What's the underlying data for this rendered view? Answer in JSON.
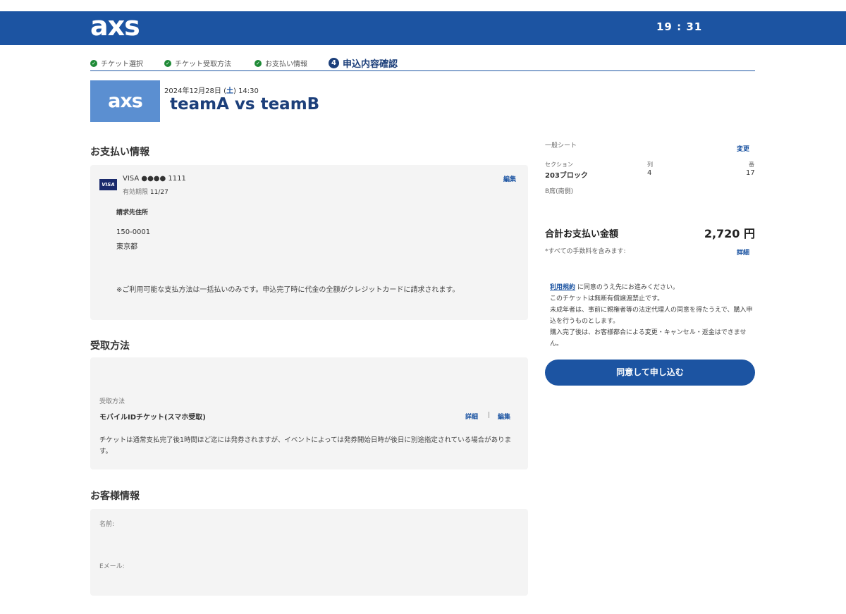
{
  "header": {
    "logo": "axs",
    "timer": "19 : 31"
  },
  "steps": [
    {
      "label": "チケット選択",
      "status": "done"
    },
    {
      "label": "チケット受取方法",
      "status": "done"
    },
    {
      "label": "お支払い情報",
      "status": "done"
    },
    {
      "label": "申込内容確認",
      "status": "active",
      "number": "4"
    }
  ],
  "event": {
    "logo": "axs",
    "date_prefix": "2024年12月28日 (",
    "day": "土",
    "date_suffix": ") 14:30",
    "title": "teamA vs teamB"
  },
  "payment": {
    "section_title": "お支払い情報",
    "card_brand_badge": "VISA",
    "card_line": "VISA ●●●● 1111",
    "expiry_label": "有効期限",
    "expiry_value": "11/27",
    "edit_label": "編集",
    "billing_label": "請求先住所",
    "postal_code": "150-0001",
    "prefecture": "東京都",
    "note": "※ご利用可能な支払方法は一括払いのみです。申込完了時に代金の全額がクレジットカードに請求されます。"
  },
  "delivery": {
    "section_title": "受取方法",
    "method_label": "受取方法",
    "method_value": "モバイルIDチケット(スマホ受取)",
    "details_label": "詳細",
    "separator": "|",
    "edit_label": "編集",
    "note": "チケットは通常支払完了後1時間ほど迄には発券されますが、イベントによっては発券開始日時が後日に別途指定されている場合があります。"
  },
  "customer": {
    "section_title": "お客様情報",
    "name_label": "名前:",
    "email_label": "Eメール:"
  },
  "ticket_summary": {
    "seat_type": "一般シート",
    "change_label": "変更",
    "section_label": "セクション",
    "section_value": "203ブロック",
    "row_label": "列",
    "row_value": "4",
    "seat_label": "番",
    "seat_value": "17",
    "area": "B席(南側)"
  },
  "total": {
    "label": "合計お支払い金額",
    "amount": "2,720 円",
    "fee_note": "*すべての手数料を含みます:",
    "details_label": "詳細"
  },
  "terms": {
    "link_text": "利用規約",
    "line1_rest": "に同意のうえ先にお進みください。",
    "line2": "このチケットは無断有償譲渡禁止です。",
    "line3": "未成年者は、事前に親権者等の法定代理人の同意を得たうえで、購入申込を行うものとします。",
    "line4": "購入完了後は、お客様都合による変更・キャンセル・返金はできません。"
  },
  "submit": {
    "label": "同意して申し込む"
  },
  "colors": {
    "brand_blue": "#1c54a2",
    "navy": "#1c3f7a",
    "check_green": "#1e8a36",
    "card_bg": "#f4f4f4"
  }
}
